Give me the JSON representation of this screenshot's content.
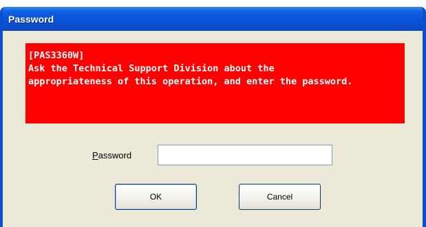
{
  "window": {
    "title": "Password"
  },
  "message": {
    "lines": [
      "[PAS3360W]",
      "Ask the Technical Support Division about the",
      "appropriateness of this operation, and enter the password."
    ],
    "background_color": "#ff0000",
    "text_color": "#ffffff"
  },
  "password_field": {
    "label_accel": "P",
    "label_rest": "assword",
    "value": ""
  },
  "buttons": {
    "ok_label": "OK",
    "cancel_label": "Cancel"
  },
  "colors": {
    "titlebar": "#0852d8",
    "dialog_background": "#ece9d8"
  }
}
